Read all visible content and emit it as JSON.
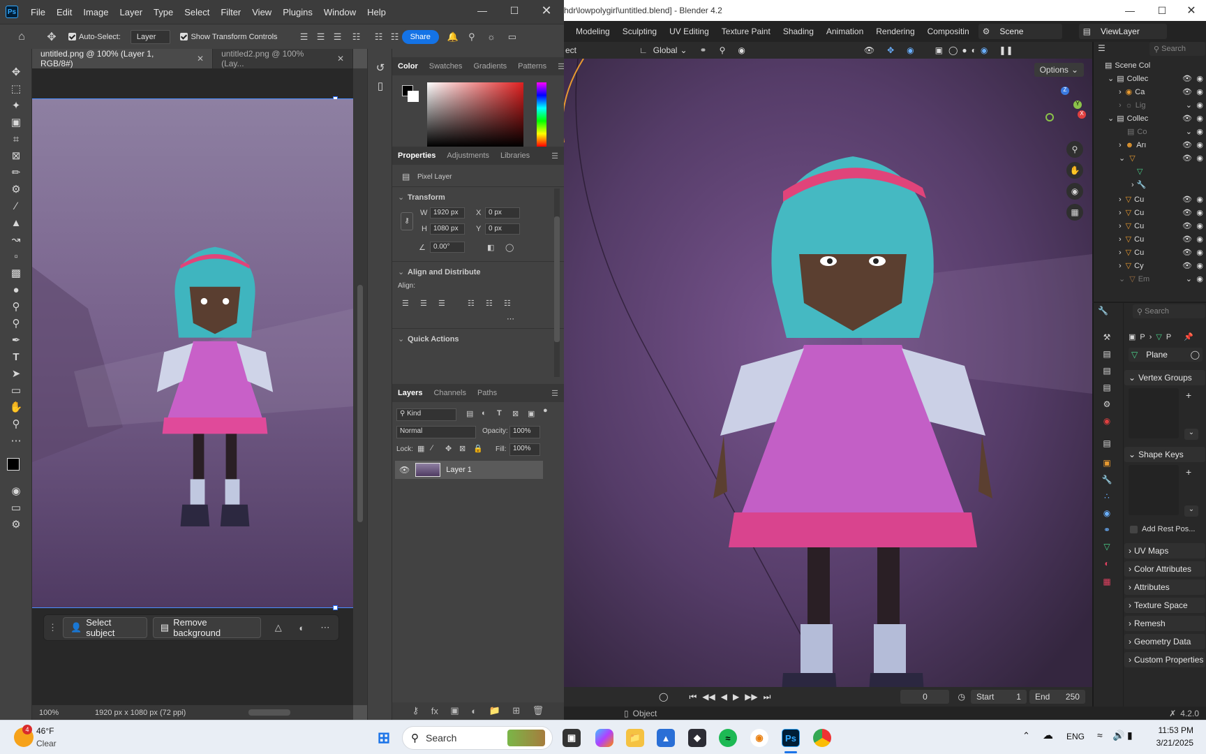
{
  "photoshop": {
    "menu": [
      "File",
      "Edit",
      "Image",
      "Layer",
      "Type",
      "Select",
      "Filter",
      "View",
      "Plugins",
      "Window",
      "Help"
    ],
    "options": {
      "auto_select_label": "Auto-Select:",
      "auto_select_value": "Layer",
      "show_transform_label": "Show Transform Controls",
      "share_label": "Share"
    },
    "doc_tabs": [
      "untitled.png @ 100% (Layer 1, RGB/8#)",
      "untitled2.png @ 100% (Lay..."
    ],
    "status": {
      "zoom": "100%",
      "dimensions": "1920 px x 1080 px (72 ppi)"
    },
    "context_bar": {
      "select_subject": "Select subject",
      "remove_background": "Remove background"
    },
    "color_panel": {
      "tabs": [
        "Color",
        "Swatches",
        "Gradients",
        "Patterns"
      ]
    },
    "properties": {
      "tabs": [
        "Properties",
        "Adjustments",
        "Libraries"
      ],
      "layer_type": "Pixel Layer",
      "transform_title": "Transform",
      "w_label": "W",
      "w_value": "1920 px",
      "h_label": "H",
      "h_value": "1080 px",
      "x_label": "X",
      "x_value": "0 px",
      "y_label": "Y",
      "y_value": "0 px",
      "angle_value": "0.00°",
      "align_title": "Align and Distribute",
      "align_label": "Align:",
      "quick_actions_title": "Quick Actions"
    },
    "layers": {
      "tabs": [
        "Layers",
        "Channels",
        "Paths"
      ],
      "kind_label": "Kind",
      "blend_mode": "Normal",
      "opacity_label": "Opacity:",
      "opacity_value": "100%",
      "lock_label": "Lock:",
      "fill_label": "Fill:",
      "fill_value": "100%",
      "items": [
        {
          "name": "Layer 1"
        }
      ]
    }
  },
  "blender": {
    "title": "hdr\\lowpolygirl\\untitled.blend] - Blender 4.2",
    "workspaces": [
      "Modeling",
      "Sculpting",
      "UV Editing",
      "Texture Paint",
      "Shading",
      "Animation",
      "Rendering",
      "Compositin"
    ],
    "scene": "Scene",
    "view_layer": "ViewLayer",
    "viewport": {
      "mode_text": "ect",
      "orientation": "Global",
      "options_label": "Options"
    },
    "search_placeholder": "Search",
    "outliner_search": "Search",
    "outliner_rows": [
      "Scene Col",
      "Collec",
      "Ca",
      "Lig",
      "Collec",
      "Co",
      "Arı",
      "",
      "",
      "Cu",
      "Cu",
      "Cu",
      "Cu",
      "Cu",
      "Cy",
      "Em"
    ],
    "properties": {
      "breadcrumb": [
        "P",
        "P"
      ],
      "object_name": "Plane",
      "vertex_groups": "Vertex Groups",
      "shape_keys": "Shape Keys",
      "add_rest_pos": "Add Rest Pos...",
      "sections": [
        "UV Maps",
        "Color Attributes",
        "Attributes",
        "Texture Space",
        "Remesh",
        "Geometry Data",
        "Custom Properties"
      ]
    },
    "timeline": {
      "current_frame": "0",
      "start_label": "Start",
      "start_value": "1",
      "end_label": "End",
      "end_value": "250"
    },
    "statusbar": {
      "mode": "Object",
      "version": "4.2.0"
    }
  },
  "taskbar": {
    "weather_temp": "46°F",
    "weather_text": "Clear",
    "weather_badge": "4",
    "search_label": "Search",
    "language": "ENG",
    "time": "11:53 PM",
    "date": "3/21/2025"
  }
}
